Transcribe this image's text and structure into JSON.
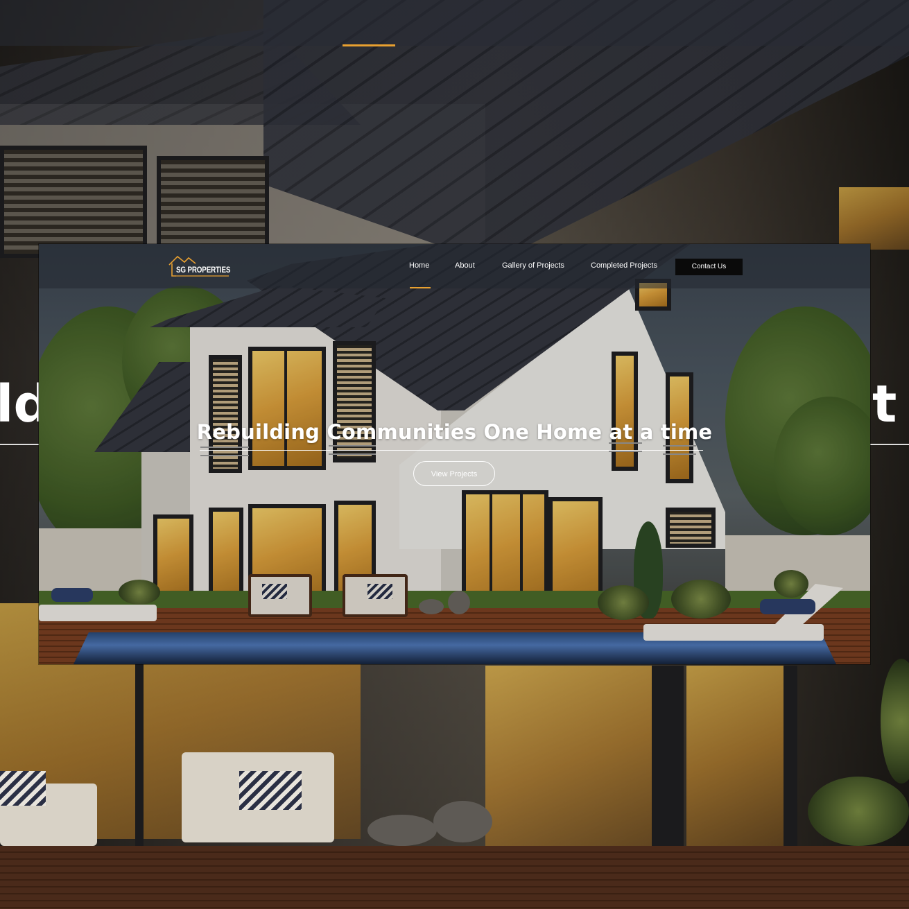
{
  "brand": {
    "logo_text": "SG PROPERTIES",
    "accent_color": "#e8a030"
  },
  "nav": {
    "items": [
      {
        "label": "Home",
        "active": true
      },
      {
        "label": "About"
      },
      {
        "label": "Gallery of Projects"
      },
      {
        "label": "Completed Projects"
      }
    ],
    "contact_label": "Contact Us"
  },
  "hero": {
    "title": "Rebuilding Communities One Home at a time",
    "button_label": "View Projects",
    "background_image": "modern-house-with-pool"
  },
  "backdrop": {
    "fragment_left": "ld",
    "fragment_right": "t"
  }
}
